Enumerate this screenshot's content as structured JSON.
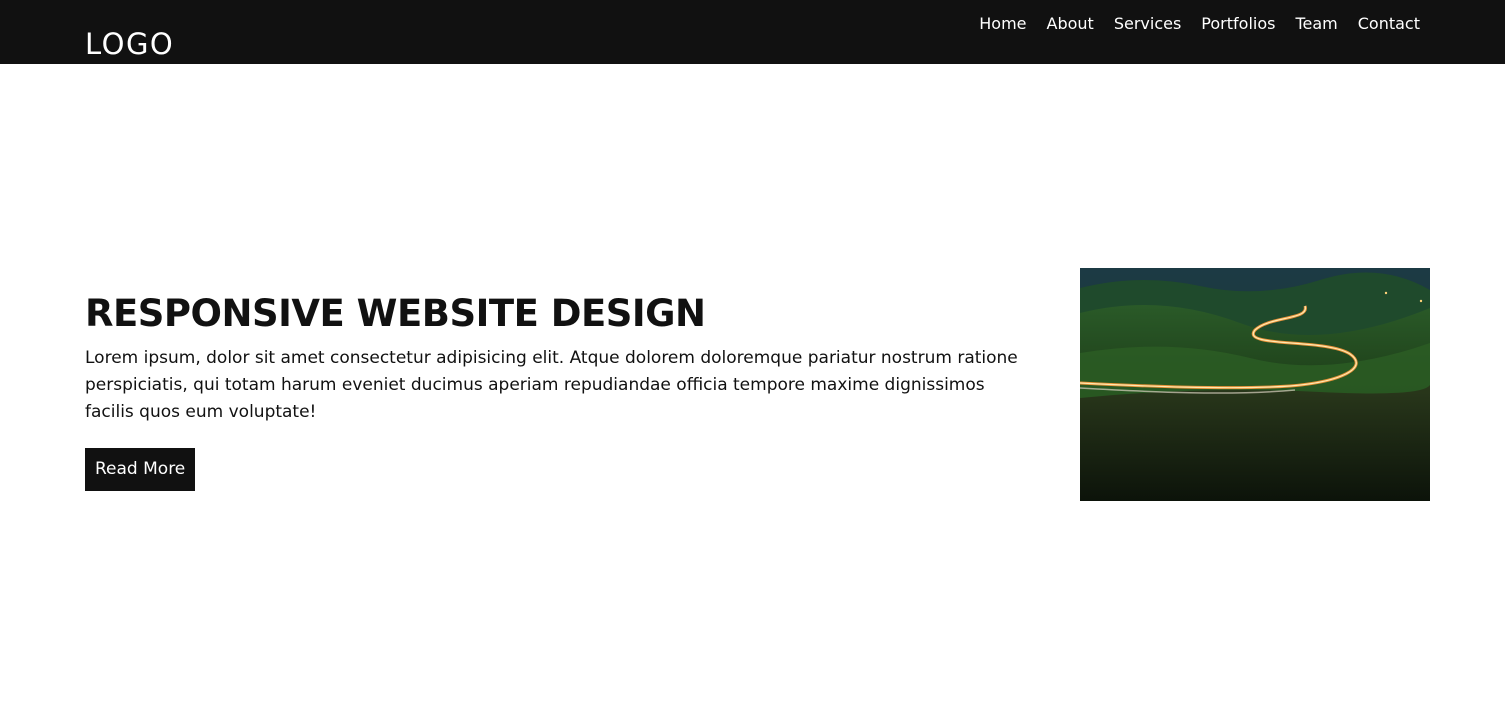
{
  "header": {
    "logo": "LOGO",
    "nav": [
      "Home",
      "About",
      "Services",
      "Portfolios",
      "Team",
      "Contact"
    ]
  },
  "hero": {
    "title": "RESPONSIVE WEBSITE DESIGN",
    "description": "Lorem ipsum, dolor sit amet consectetur adipisicing elit. Atque dolorem doloremque pariatur nostrum ratione perspiciatis, qui totam harum eveniet ducimus aperiam repudiandae officia tempore maxime dignissimos facilis quos eum voluptate!",
    "button_label": "Read More"
  },
  "colors": {
    "header_bg": "#111111",
    "button_bg": "#111111",
    "text": "#111111",
    "background": "#ffffff"
  }
}
